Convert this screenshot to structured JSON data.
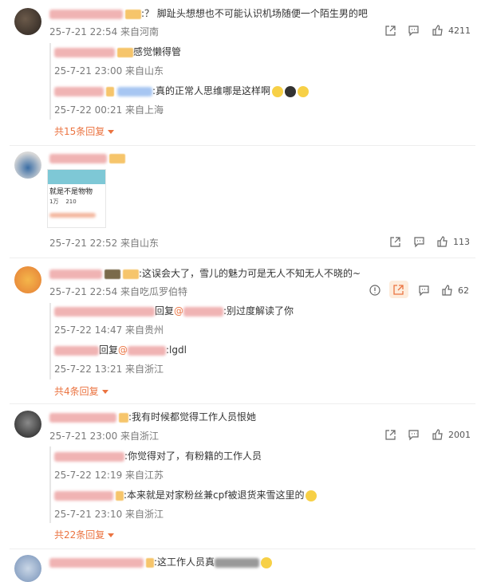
{
  "comments": [
    {
      "text": ":？ 脚趾头想想也不可能认识机场随便一个陌生男的吧",
      "meta": "25-7-21 22:54 来自河南",
      "likes": "4211",
      "replies": [
        {
          "text": "感觉懒得管",
          "meta": "25-7-21 23:00 来自山东"
        },
        {
          "text": ":真的正常人思维哪是这样啊",
          "meta": "25-7-22 00:21 来自上海"
        }
      ],
      "more": "共15条回复"
    },
    {
      "image_text": "就是不是物物",
      "image_stats": "1万    210",
      "meta": "25-7-21 22:52 来自山东",
      "likes": "113"
    },
    {
      "text": ":这误会大了，雪儿的魅力可是无人不知无人不晓的~",
      "meta": "25-7-21 22:54 来自吃瓜罗伯特",
      "likes": "62",
      "replies": [
        {
          "prefix": "回复",
          "mention": "@",
          "text": ":别过度解读了你",
          "meta": "25-7-22 14:47 来自贵州"
        },
        {
          "prefix": "回复",
          "mention": "@",
          "text": ":lgdl",
          "meta": "25-7-22 13:21 来自浙江"
        }
      ],
      "more": "共4条回复"
    },
    {
      "text": ":我有时候都觉得工作人员恨她",
      "meta": "25-7-21 23:00 来自浙江",
      "likes": "2001",
      "replies": [
        {
          "text": ":你觉得对了，有粉籍的工作人员",
          "meta": "25-7-22 12:19 来自江苏"
        },
        {
          "text": ":本来就是对家粉丝兼cpf被退货来雪这里的",
          "meta": "25-7-21 23:10 来自浙江"
        }
      ],
      "more": "共22条回复"
    },
    {
      "text": ":这工作人员真"
    }
  ],
  "colors": {
    "accent": "#eb7340",
    "meta": "#7a7a7a"
  }
}
